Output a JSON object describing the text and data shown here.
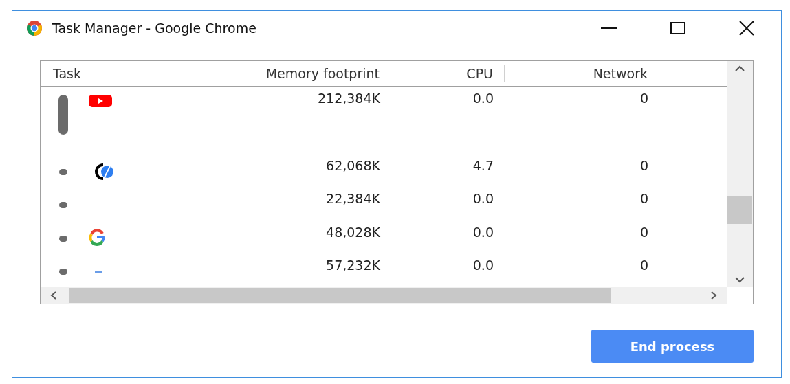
{
  "window": {
    "title": "Task Manager - Google Chrome"
  },
  "table": {
    "columns": [
      "Task",
      "Memory footprint",
      "CPU",
      "Network"
    ],
    "rows": [
      {
        "kind": "group",
        "memory": "212,384K",
        "cpu": "0.0",
        "network": "0"
      },
      {
        "kind": "single",
        "memory": "62,068K",
        "cpu": "4.7",
        "network": "0"
      },
      {
        "kind": "single",
        "memory": "22,384K",
        "cpu": "0.0",
        "network": "0"
      },
      {
        "kind": "single",
        "memory": "48,028K",
        "cpu": "0.0",
        "network": "0"
      },
      {
        "kind": "single",
        "memory": "57,232K",
        "cpu": "0.0",
        "network": "0"
      }
    ]
  },
  "buttons": [
    "End process"
  ]
}
